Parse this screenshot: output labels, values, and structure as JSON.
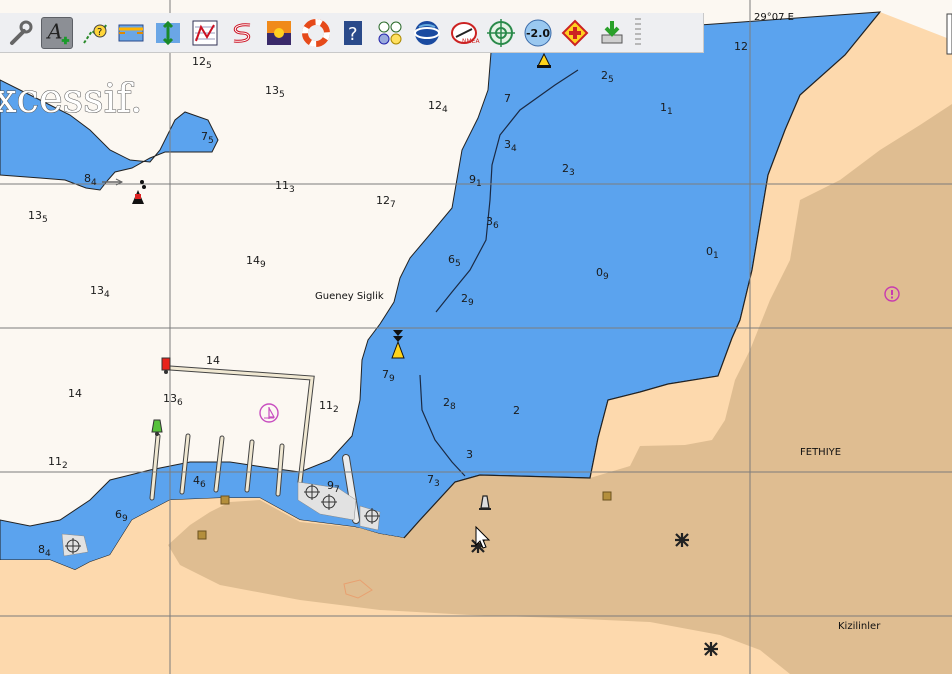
{
  "coordinate_label": "29°07 E",
  "bg_text": "xcessif.",
  "place_names": {
    "gueney": "Gueney Siglik",
    "fethiye": "FETHIYE",
    "kizilinler": "Kizilinler"
  },
  "soundings": [
    {
      "id": "s1",
      "main": "12",
      "sub": "5"
    },
    {
      "id": "s2",
      "main": "13",
      "sub": "5"
    },
    {
      "id": "s3",
      "main": "12",
      "sub": "4"
    },
    {
      "id": "s4",
      "main": "7",
      "sub": ""
    },
    {
      "id": "s5",
      "main": "2",
      "sub": "5"
    },
    {
      "id": "s6",
      "main": "1",
      "sub": "1"
    },
    {
      "id": "s7",
      "main": "12",
      "sub": ""
    },
    {
      "id": "s8",
      "main": "7",
      "sub": "5"
    },
    {
      "id": "s9",
      "main": "3",
      "sub": "4"
    },
    {
      "id": "s10",
      "main": "2",
      "sub": "3"
    },
    {
      "id": "s11",
      "main": "8",
      "sub": "4"
    },
    {
      "id": "s12",
      "main": "11",
      "sub": "3"
    },
    {
      "id": "s13",
      "main": "9",
      "sub": "1"
    },
    {
      "id": "s14",
      "main": "13",
      "sub": "5"
    },
    {
      "id": "s15",
      "main": "12",
      "sub": "7"
    },
    {
      "id": "s16",
      "main": "3",
      "sub": "6"
    },
    {
      "id": "s17",
      "main": "0",
      "sub": "1"
    },
    {
      "id": "s18",
      "main": "14",
      "sub": "9"
    },
    {
      "id": "s19",
      "main": "6",
      "sub": "5"
    },
    {
      "id": "s20",
      "main": "0",
      "sub": "9"
    },
    {
      "id": "s21",
      "main": "13",
      "sub": "4"
    },
    {
      "id": "s22",
      "main": "2",
      "sub": "9"
    },
    {
      "id": "s23",
      "main": "14",
      "sub": ""
    },
    {
      "id": "s24",
      "main": "7",
      "sub": "9"
    },
    {
      "id": "s25",
      "main": "14",
      "sub": ""
    },
    {
      "id": "s26",
      "main": "13",
      "sub": "6"
    },
    {
      "id": "s27",
      "main": "11",
      "sub": "2"
    },
    {
      "id": "s28",
      "main": "2",
      "sub": "8"
    },
    {
      "id": "s29",
      "main": "2",
      "sub": ""
    },
    {
      "id": "s30",
      "main": "11",
      "sub": "2"
    },
    {
      "id": "s31",
      "main": "3",
      "sub": ""
    },
    {
      "id": "s32",
      "main": "4",
      "sub": "6"
    },
    {
      "id": "s33",
      "main": "9",
      "sub": "7"
    },
    {
      "id": "s34",
      "main": "7",
      "sub": "3"
    },
    {
      "id": "s35",
      "main": "6",
      "sub": "9"
    },
    {
      "id": "s36",
      "main": "8",
      "sub": "4"
    }
  ],
  "toolbar": [
    {
      "id": "settings",
      "icon": "wrench-icon"
    },
    {
      "id": "text-tool",
      "icon": "text-add-icon",
      "active": true
    },
    {
      "id": "route-tool",
      "icon": "route-help-icon"
    },
    {
      "id": "overview",
      "icon": "layers-icon"
    },
    {
      "id": "depth",
      "icon": "depth-icon"
    },
    {
      "id": "tracks",
      "icon": "track-chart-icon"
    },
    {
      "id": "route",
      "icon": "route-s-icon"
    },
    {
      "id": "sunset",
      "icon": "sunset-icon"
    },
    {
      "id": "lifebuoy",
      "icon": "lifebuoy-icon"
    },
    {
      "id": "help",
      "icon": "help-book-icon"
    },
    {
      "id": "instruments",
      "icon": "instruments-icon"
    },
    {
      "id": "globe",
      "icon": "globe-icon"
    },
    {
      "id": "boat-nmea",
      "icon": "boat-nmea-icon"
    },
    {
      "id": "target",
      "icon": "target-icon"
    },
    {
      "id": "zoom",
      "icon": "zoom-value-icon",
      "label": "-2.0"
    },
    {
      "id": "medical",
      "icon": "first-aid-icon"
    },
    {
      "id": "download",
      "icon": "download-icon"
    }
  ],
  "colors": {
    "water": "#5ba3ee",
    "land": "#fdd9ad",
    "land_dark": "#dfbd91",
    "shallow": "#fcf8f2",
    "grid": "#7c7c7c",
    "coast": "#222222"
  }
}
